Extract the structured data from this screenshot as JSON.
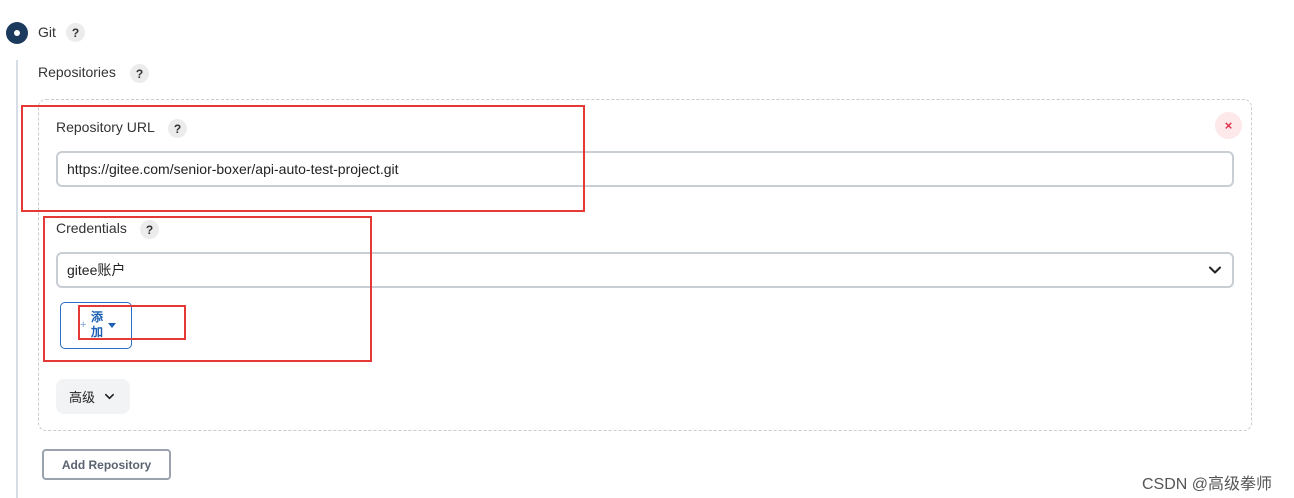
{
  "scm": {
    "option_label": "Git",
    "help": "?"
  },
  "repositories": {
    "label": "Repositories",
    "help": "?"
  },
  "repository_url": {
    "label": "Repository URL",
    "help": "?",
    "value": "https://gitee.com/senior-boxer/api-auto-test-project.git",
    "remove_icon": "×"
  },
  "credentials": {
    "label": "Credentials",
    "help": "?",
    "selected": "gitee账户",
    "add_plus": "+",
    "add_label": "添加"
  },
  "advanced": {
    "label": "高级"
  },
  "add_repository": {
    "label": "Add Repository"
  },
  "watermark": "CSDN @高级拳师",
  "colors": {
    "radio": "#1b3a5c",
    "annotation_red": "#e53935",
    "link_blue": "#1a5fb4"
  }
}
